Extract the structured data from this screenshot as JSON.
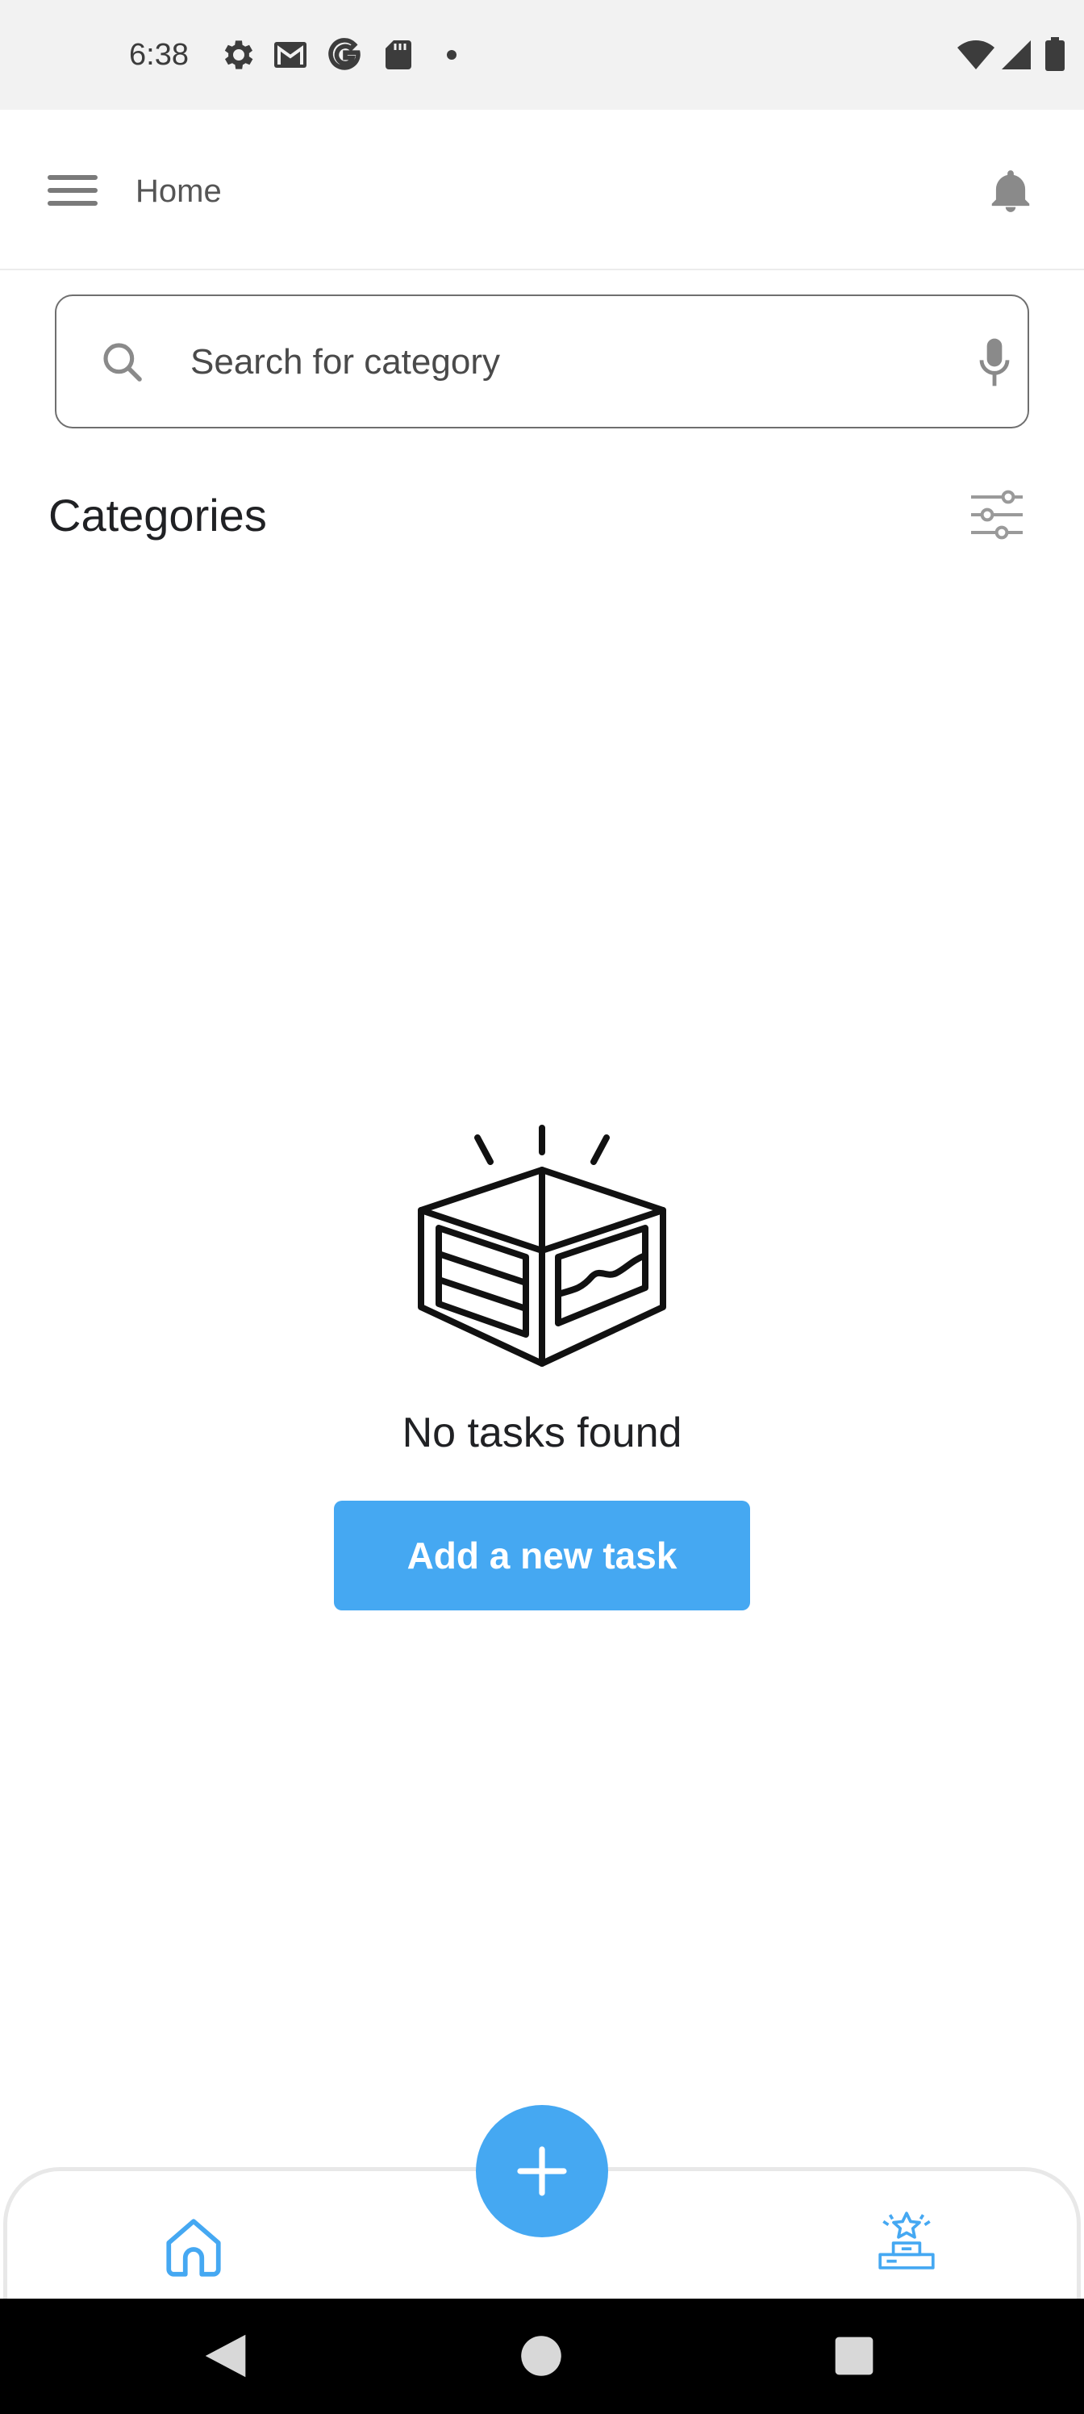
{
  "status_bar": {
    "time": "6:38",
    "icons": [
      "settings-icon",
      "gmail-icon",
      "google-icon",
      "sd-card-icon",
      "dot-icon",
      "wifi-icon",
      "cellular-signal-icon",
      "battery-icon"
    ]
  },
  "app_bar": {
    "title": "Home",
    "icons": [
      "menu-icon",
      "bell-icon"
    ]
  },
  "search": {
    "placeholder": "Search for category",
    "value": "",
    "icons": [
      "search-icon",
      "mic-icon"
    ]
  },
  "categories": {
    "title": "Categories",
    "filter_icon": "sliders-icon"
  },
  "empty_state": {
    "illustration": "open-box-icon",
    "message": "No tasks found",
    "button_label": "Add a new task"
  },
  "bottom_nav": {
    "items": [
      {
        "icon": "home-icon",
        "active": true
      },
      {
        "icon": "podium-star-icon",
        "active": false
      }
    ],
    "fab_icon": "plus-icon"
  },
  "system_nav": {
    "buttons": [
      "back-icon",
      "home-circle-icon",
      "recents-square-icon"
    ]
  },
  "colors": {
    "accent": "#45a8f2",
    "status_bar_bg": "#f2f2f2",
    "system_nav_bg": "#000000",
    "text_primary": "#202124",
    "icon_gray": "#8a8a8a"
  }
}
